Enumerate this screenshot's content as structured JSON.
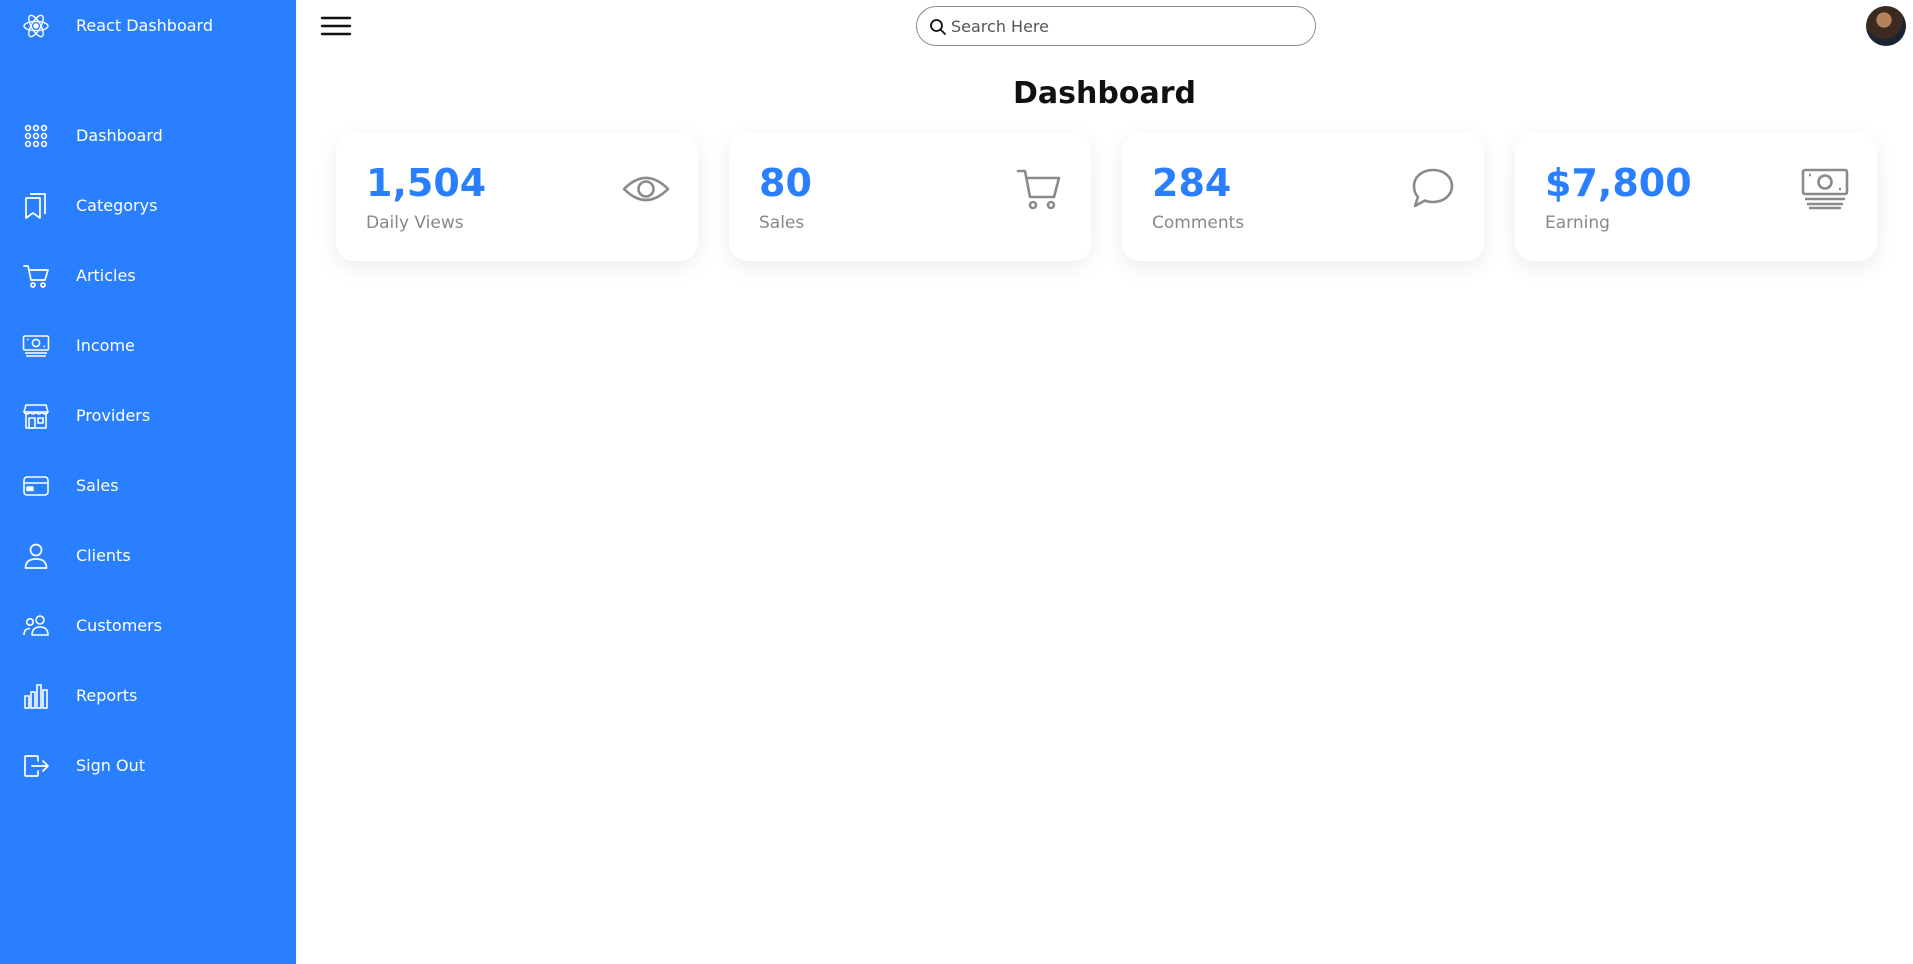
{
  "sidebar": {
    "brand": {
      "label": "React Dashboard",
      "icon": "react-icon"
    },
    "items": [
      {
        "label": "Dashboard",
        "icon": "grid-icon"
      },
      {
        "label": "Categorys",
        "icon": "bookmarks-icon"
      },
      {
        "label": "Articles",
        "icon": "cart-icon"
      },
      {
        "label": "Income",
        "icon": "cash-icon"
      },
      {
        "label": "Providers",
        "icon": "shop-icon"
      },
      {
        "label": "Sales",
        "icon": "credit-card-icon"
      },
      {
        "label": "Clients",
        "icon": "person-icon"
      },
      {
        "label": "Customers",
        "icon": "people-icon"
      },
      {
        "label": "Reports",
        "icon": "bar-chart-icon"
      },
      {
        "label": "Sign Out",
        "icon": "box-arrow-right-icon"
      }
    ],
    "background_color": "#2a7fff"
  },
  "header": {
    "menu_icon": "hamburger-menu-icon",
    "search": {
      "placeholder": "Search Here",
      "value": ""
    },
    "avatar": "user-avatar"
  },
  "main": {
    "title": "Dashboard",
    "cards": [
      {
        "number": "1,504",
        "caption": "Daily Views",
        "icon": "eye-icon"
      },
      {
        "number": "80",
        "caption": "Sales",
        "icon": "cart-icon"
      },
      {
        "number": "284",
        "caption": "Comments",
        "icon": "chat-icon"
      },
      {
        "number": "$7,800",
        "caption": "Earning",
        "icon": "cash-icon"
      }
    ],
    "accent_color": "#2a7fff",
    "muted_icon_color": "#8a8a8a"
  }
}
